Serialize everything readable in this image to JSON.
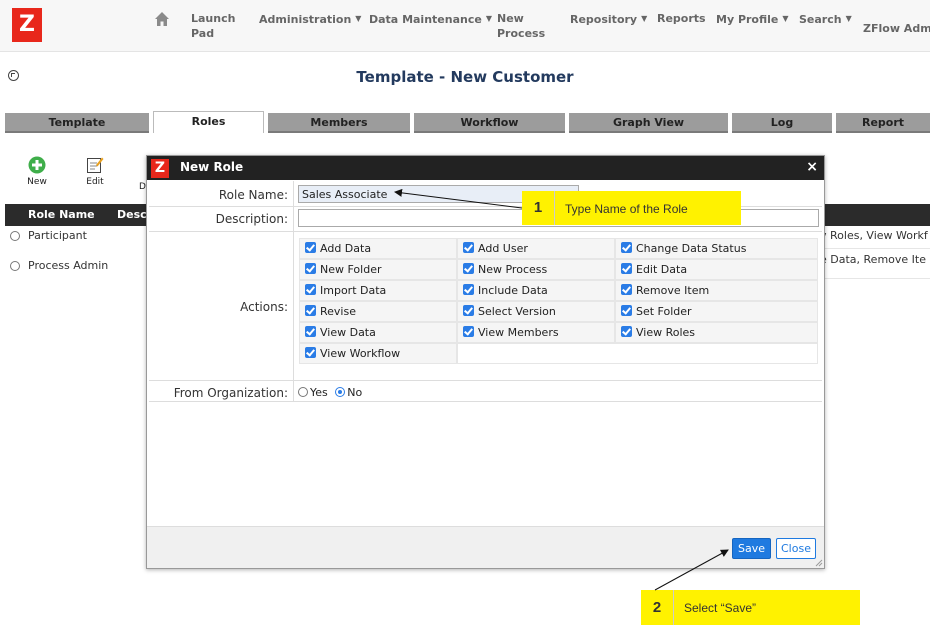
{
  "nav": {
    "items": [
      {
        "label": "Launch\nPad",
        "has_caret": false
      },
      {
        "label": "Administration",
        "has_caret": true
      },
      {
        "label": "Data Maintenance",
        "has_caret": true
      },
      {
        "label": "New\nProcess",
        "has_caret": false
      },
      {
        "label": "Repository",
        "has_caret": true
      },
      {
        "label": "Reports",
        "has_caret": false
      },
      {
        "label": "My Profile",
        "has_caret": true
      },
      {
        "label": "Search",
        "has_caret": true
      },
      {
        "label": "ZFlow Admi",
        "has_caret": false
      }
    ],
    "logo_letter": "Z"
  },
  "page": {
    "title": "Template - New Customer"
  },
  "tabs": [
    "Template",
    "Roles",
    "Members",
    "Workflow",
    "Graph View",
    "Log",
    "Report"
  ],
  "active_tab": "Roles",
  "toolbar": {
    "new_label": "New",
    "edit_label": "Edit",
    "delete_label": "D"
  },
  "grid": {
    "headers": [
      "Role Name",
      "Desc"
    ],
    "rows": [
      {
        "name": "Participant",
        "actions_tail": "v Roles, View Workf"
      },
      {
        "name": "Process Admin",
        "actions_tail": "e Data, Remove Ite"
      }
    ]
  },
  "dialog": {
    "logo_letter": "Z",
    "title": "New Role",
    "close_glyph": "×",
    "role_name_label": "Role Name:",
    "role_name_value": "Sales Associate",
    "description_label": "Description:",
    "description_value": "",
    "actions_label": "Actions:",
    "actions": [
      "Add Data",
      "Add User",
      "Change Data Status",
      "New Folder",
      "New Process",
      "Edit Data",
      "Import Data",
      "Include Data",
      "Remove Item",
      "Revise",
      "Select Version",
      "Set Folder",
      "View Data",
      "View Members",
      "View Roles",
      "View Workflow"
    ],
    "from_org_label": "From Organization:",
    "from_org_yes": "Yes",
    "from_org_no": "No",
    "from_org_selected": "No",
    "save_label": "Save",
    "close_label": "Close"
  },
  "callouts": [
    {
      "num": "1",
      "text": "Type Name of the Role"
    },
    {
      "num": "2",
      "text": "Select “Save”"
    }
  ],
  "colors": {
    "accent": "#1f7ae0",
    "logo": "#e8271b",
    "callout": "#fff200",
    "header": "#222222"
  }
}
